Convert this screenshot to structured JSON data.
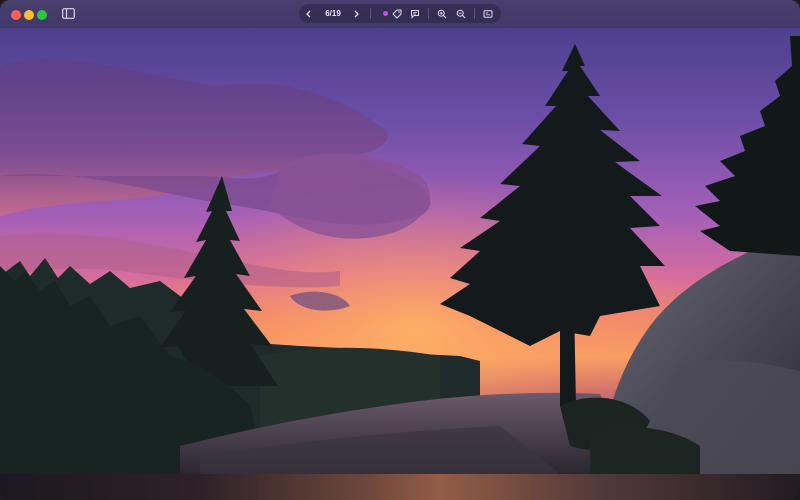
{
  "viewer": {
    "page_counter": "6/19"
  },
  "toolbar": {
    "icons": [
      "chevron-left-icon",
      "chevron-right-icon",
      "tag-icon",
      "comment-icon",
      "zoom-in-icon",
      "zoom-out-icon",
      "info-icon"
    ],
    "tag_color": "#c54ee0"
  },
  "traffic_lights": {
    "close": "#ff5f57",
    "minimize": "#febc2e",
    "zoom": "#28c840"
  }
}
